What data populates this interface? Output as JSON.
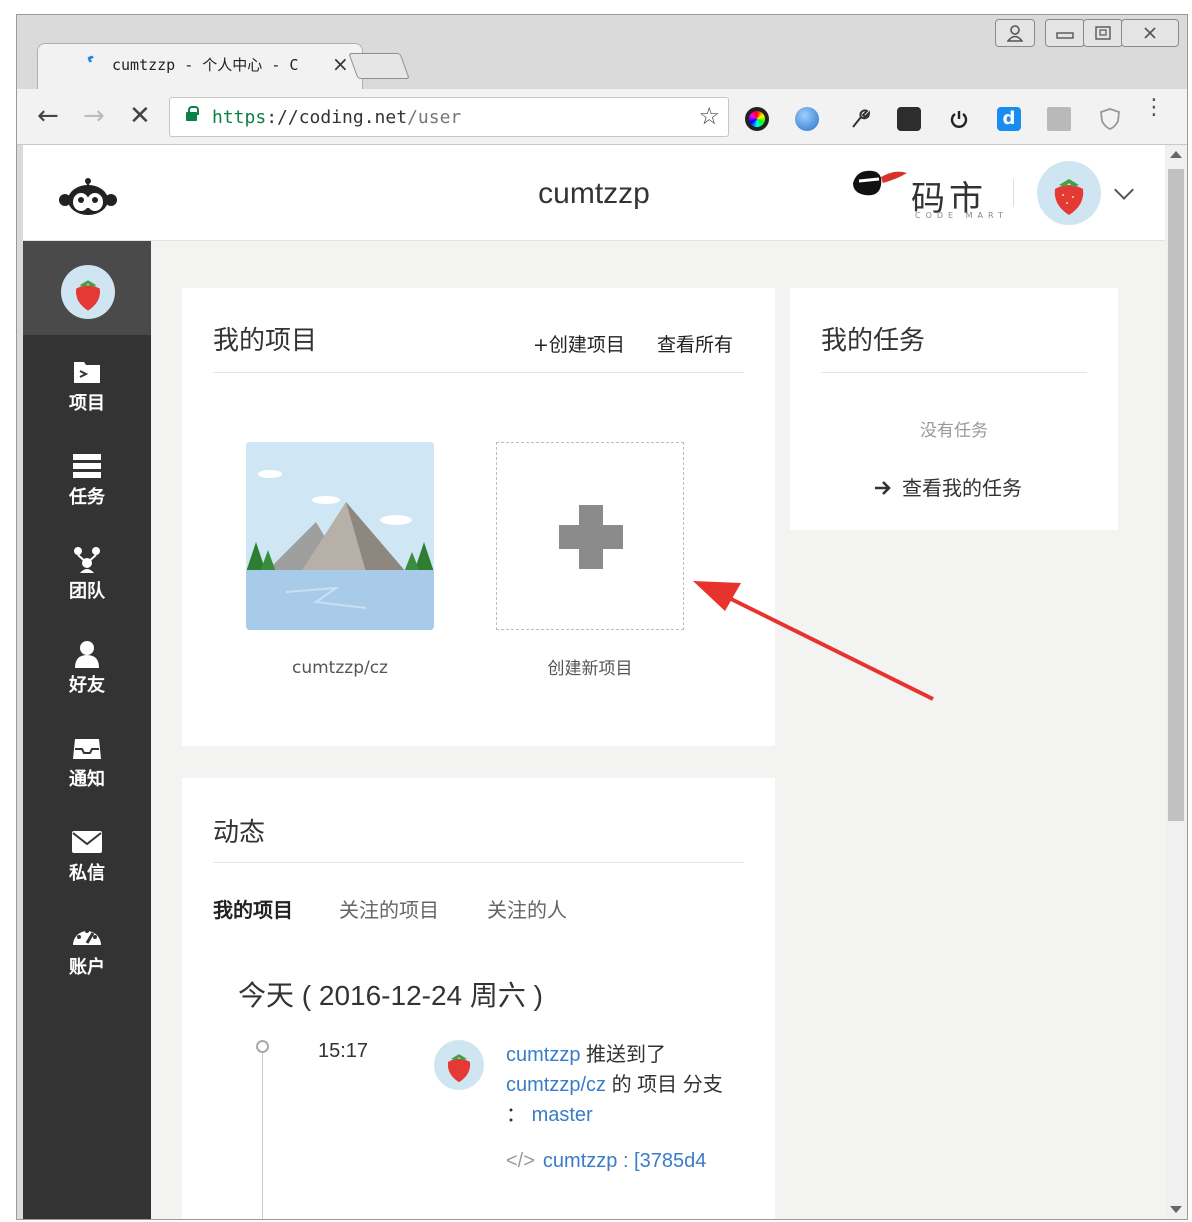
{
  "browser": {
    "tab_title": "cumtzzp - 个人中心 - C",
    "tab_close": "×",
    "url_scheme": "https",
    "url_host": "://coding.net",
    "url_path": "/user",
    "window_buttons": [
      "8",
      "▭",
      "▢",
      "✕"
    ],
    "nav": {
      "back": "←",
      "forward": "→",
      "stop": "✕"
    },
    "star": "☆",
    "menu": "⋮",
    "extensions": [
      "color-wheel-icon",
      "globe-icon",
      "tool-icon",
      "evernote-icon",
      "power-icon",
      "d-icon",
      "reader-icon",
      "shield-icon"
    ]
  },
  "header": {
    "username": "cumtzzp",
    "codemart_title": "码市",
    "codemart_sub": "CODE MART"
  },
  "sidebar": {
    "items": [
      {
        "label": "项目",
        "icon": "folder-icon"
      },
      {
        "label": "任务",
        "icon": "tasks-icon"
      },
      {
        "label": "团队",
        "icon": "team-icon"
      },
      {
        "label": "好友",
        "icon": "friend-icon"
      },
      {
        "label": "通知",
        "icon": "inbox-icon"
      },
      {
        "label": "私信",
        "icon": "mail-icon"
      },
      {
        "label": "账户",
        "icon": "dashboard-icon"
      }
    ]
  },
  "projects": {
    "title": "我的项目",
    "create_link": "+创建项目",
    "view_all": "查看所有",
    "items": [
      {
        "name": "cumtzzp/cz"
      }
    ],
    "new_project_label": "创建新项目"
  },
  "tasks": {
    "title": "我的任务",
    "empty": "没有任务",
    "view_mine": "查看我的任务"
  },
  "activity": {
    "title": "动态",
    "tabs": [
      "我的项目",
      "关注的项目",
      "关注的人"
    ],
    "date": "今天 ( 2016-12-24 周六 )",
    "event": {
      "time": "15:17",
      "user": "cumtzzp",
      "verb": " 推送到了 ",
      "repo": "cumtzzp/cz",
      "middle": " 的 项目 分支 ： ",
      "branch": "master",
      "commit_code_icon": "</>",
      "commit_text": "cumtzzp : [3785d4"
    }
  },
  "colors": {
    "sidebar_bg": "#333333",
    "link_blue": "#3a7cc7",
    "arrow_red": "#e8322d",
    "page_bg": "#f3f3f1"
  }
}
